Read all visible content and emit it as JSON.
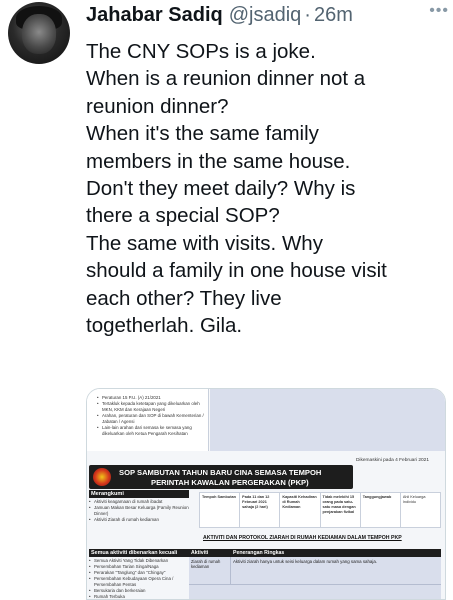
{
  "tweet": {
    "author_name": "Jahabar Sadiq",
    "author_handle": "@jsadiq",
    "separator": "·",
    "time": "26m",
    "more_icon": "more-horizontal-icon",
    "text_lines": [
      "The CNY SOPs is a joke.",
      "When is a reunion dinner not a",
      "reunion dinner?",
      "When it's the same family",
      "members in the same house.",
      "Don't they meet daily? Why is",
      "there a special SOP?",
      "The same with visits. Why",
      "should a family in one house visit",
      "each other? They live",
      "togetherlah. Gila."
    ]
  },
  "media": {
    "top_list": [
      "Peraturan 15 P.U. (A) 21/2021",
      "Tertakluk kepada ketetapan yang dikeluarkan oleh MKN, KKM dan Kerajaan Negeri",
      "Arahan, peraturan dan SOP di bawah Kementerian / Jabatan / Agensi",
      "Lain-lain arahan dari semasa ke semasa yang dikeluarkan oleh Ketua Pengarah Kesihatan"
    ],
    "date": "Dikemaskini pada 4 Februari 2021",
    "banner_line1": "SOP SAMBUTAN TAHUN BARU CINA SEMASA TEMPOH",
    "banner_line2": "PERINTAH KAWALAN PERGERAKAN (PKP)",
    "merangkumi_label": "Merangkumi",
    "merangkumi_items": [
      "Aktiviti keagamaan di rumah ibadat",
      "Jamuan Makan Besar Keluarga (Family Reunion Dinner)",
      "Aktiviti Ziarah di rumah kediaman"
    ],
    "grid_cells": [
      "Tempoh Sambutan",
      "Pada 11 dan 12 Februari 2021 sahaja (2 hari)",
      "Kapasiti Kehadiran di Rumah Kediaman",
      "Tidak melebihi 15 orang pada satu-satu masa dengan penjarakan fizikal",
      "Tanggungjawab",
      "Ahli Keluarga Individu"
    ],
    "sub_title": "AKTIVITI DAN PROTOKOL ZIARAH DI RUMAH KEDIAMAN DALAM TEMPOH PKP",
    "kecuali_label": "Semua aktiviti dibenarkan kecuali",
    "kecuali_items": [
      "Semua Aktiviti Yang Tidak Dibenarkan",
      "Persembahan Tarian Singa/Naga",
      "Perarakan \"Tanglung\" dan \"Chingay\"",
      "Persembahan Kebudayaan Opera Cina / Persembahan Pentas",
      "Bersukaria dan berkeraian",
      "Rumah Terbuka"
    ],
    "table_headers": [
      "Aktiviti",
      "Penerangan Ringkas"
    ],
    "table_rows": [
      {
        "activity": "Ziarah di rumah kediaman",
        "description": "Aktiviti ziarah hanya untuk seisi keluarga dalam rumah yang sama sahaja."
      }
    ]
  }
}
